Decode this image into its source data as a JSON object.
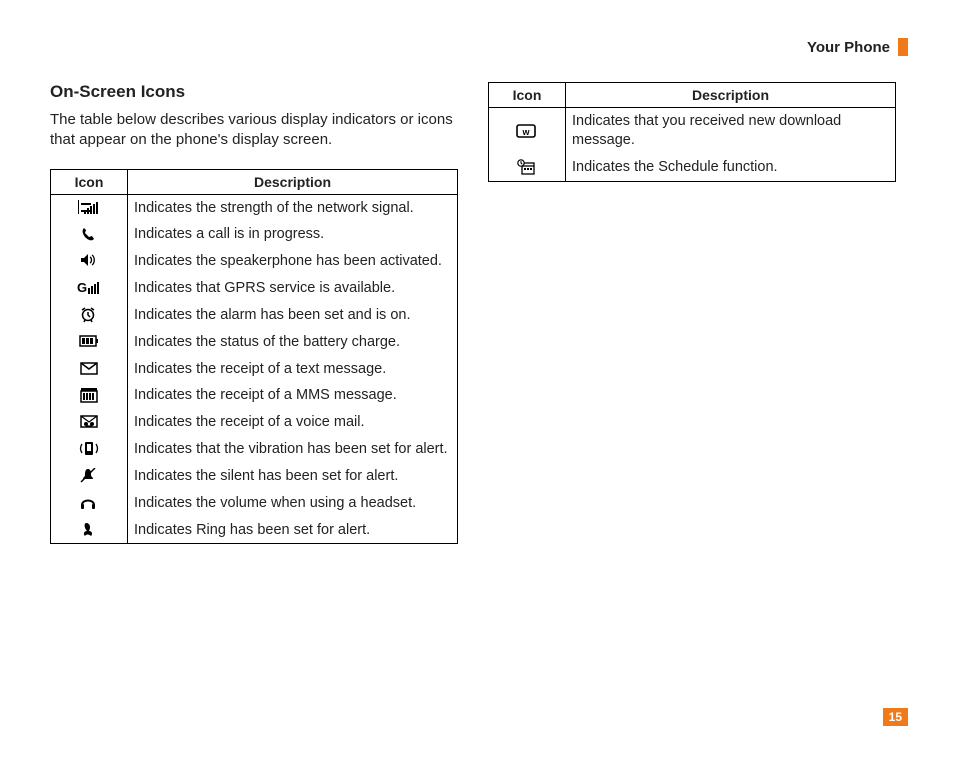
{
  "header": {
    "title": "Your Phone"
  },
  "section": {
    "title": "On-Screen Icons",
    "intro": "The table below describes various display indicators or icons that appear on the phone's display screen."
  },
  "left_table": {
    "headers": {
      "icon": "Icon",
      "description": "Description"
    },
    "rows": [
      {
        "icon": "signal-strength-icon",
        "description": "Indicates the strength of the network signal."
      },
      {
        "icon": "call-icon",
        "description": "Indicates a call is in progress."
      },
      {
        "icon": "speakerphone-icon",
        "description": "Indicates the speakerphone has been activated."
      },
      {
        "icon": "gprs-icon",
        "description": "Indicates that GPRS service is available."
      },
      {
        "icon": "alarm-icon",
        "description": "Indicates the alarm has been set and is on."
      },
      {
        "icon": "battery-icon",
        "description": "Indicates the status of the battery charge."
      },
      {
        "icon": "text-message-icon",
        "description": "Indicates the receipt of a text message."
      },
      {
        "icon": "mms-message-icon",
        "description": "Indicates the receipt of a MMS message."
      },
      {
        "icon": "voice-mail-icon",
        "description": "Indicates the receipt of a voice mail."
      },
      {
        "icon": "vibration-icon",
        "description": "Indicates that the vibration has been set for alert."
      },
      {
        "icon": "silent-icon",
        "description": "Indicates the silent has been set for alert."
      },
      {
        "icon": "headset-icon",
        "description": "Indicates the volume when using a headset."
      },
      {
        "icon": "ring-icon",
        "description": "Indicates Ring has been set for alert."
      }
    ]
  },
  "right_table": {
    "headers": {
      "icon": "Icon",
      "description": "Description"
    },
    "rows": [
      {
        "icon": "download-message-icon",
        "description": "Indicates that you received new download message."
      },
      {
        "icon": "schedule-icon",
        "description": "Indicates the Schedule function."
      }
    ]
  },
  "page_number": "15"
}
